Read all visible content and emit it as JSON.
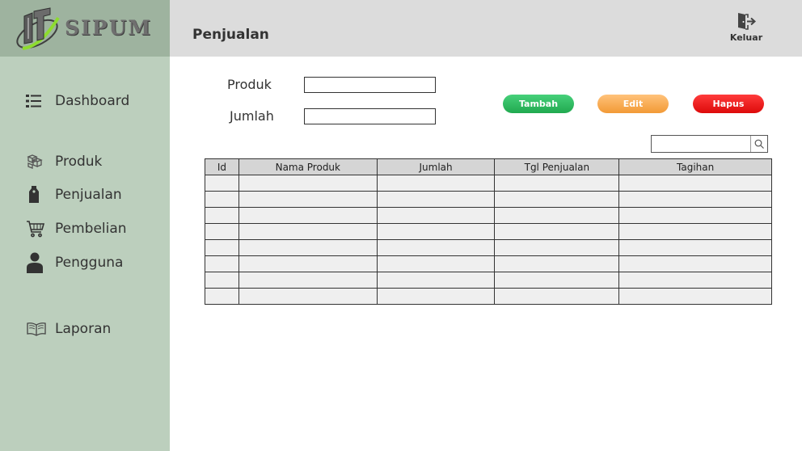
{
  "app": {
    "logo_text": "SIPUM"
  },
  "header": {
    "title": "Penjualan",
    "logout_label": "Keluar"
  },
  "sidebar": {
    "items": [
      {
        "label": "Dashboard",
        "icon": "list-icon"
      },
      {
        "label": "Produk",
        "icon": "boxes-icon"
      },
      {
        "label": "Penjualan",
        "icon": "price-tag-icon"
      },
      {
        "label": "Pembelian",
        "icon": "cart-icon"
      },
      {
        "label": "Pengguna",
        "icon": "user-icon"
      },
      {
        "label": "Laporan",
        "icon": "open-book-icon"
      }
    ]
  },
  "form": {
    "produk_label": "Produk",
    "produk_value": "",
    "jumlah_label": "Jumlah",
    "jumlah_value": ""
  },
  "buttons": {
    "add": "Tambah",
    "edit": "Edit",
    "delete": "Hapus"
  },
  "search": {
    "value": ""
  },
  "table": {
    "headers": [
      "Id",
      "Nama Produk",
      "Jumlah",
      "Tgl Penjualan",
      "Tagihan"
    ],
    "rows": [
      [
        "",
        "",
        "",
        "",
        ""
      ],
      [
        "",
        "",
        "",
        "",
        ""
      ],
      [
        "",
        "",
        "",
        "",
        ""
      ],
      [
        "",
        "",
        "",
        "",
        ""
      ],
      [
        "",
        "",
        "",
        "",
        ""
      ],
      [
        "",
        "",
        "",
        "",
        ""
      ],
      [
        "",
        "",
        "",
        "",
        ""
      ],
      [
        "",
        "",
        "",
        "",
        ""
      ]
    ]
  },
  "colors": {
    "header_bg": "#dcdcdc",
    "sidebar_bg": "#bccfbd",
    "logo_bg": "#9eb39f",
    "add_button": "#2fbf62",
    "edit_button": "#f7ae57",
    "delete_button": "#ee1414"
  }
}
